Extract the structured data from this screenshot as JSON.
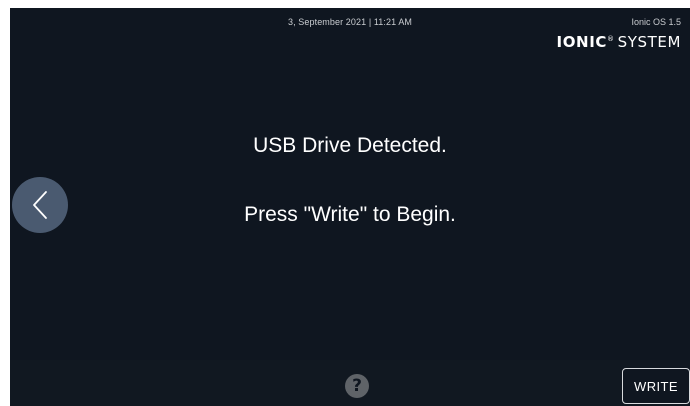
{
  "header": {
    "datetime": "3, September 2021 | 11:21 AM",
    "os_version": "Ionic OS 1.5",
    "brand_bold": "IONIC",
    "brand_reg": "®",
    "brand_suffix": "SYSTEM"
  },
  "main": {
    "line1": "USB Drive Detected.",
    "line2": "Press \"Write\" to Begin."
  },
  "footer": {
    "help_glyph": "?",
    "write_label": "WRITE"
  },
  "icons": {
    "back": "chevron-left-icon",
    "help": "question-mark-icon"
  },
  "colors": {
    "background": "#0f1620",
    "back_button": "#4a5a70",
    "help_icon": "#5f6368",
    "text": "#ffffff"
  }
}
